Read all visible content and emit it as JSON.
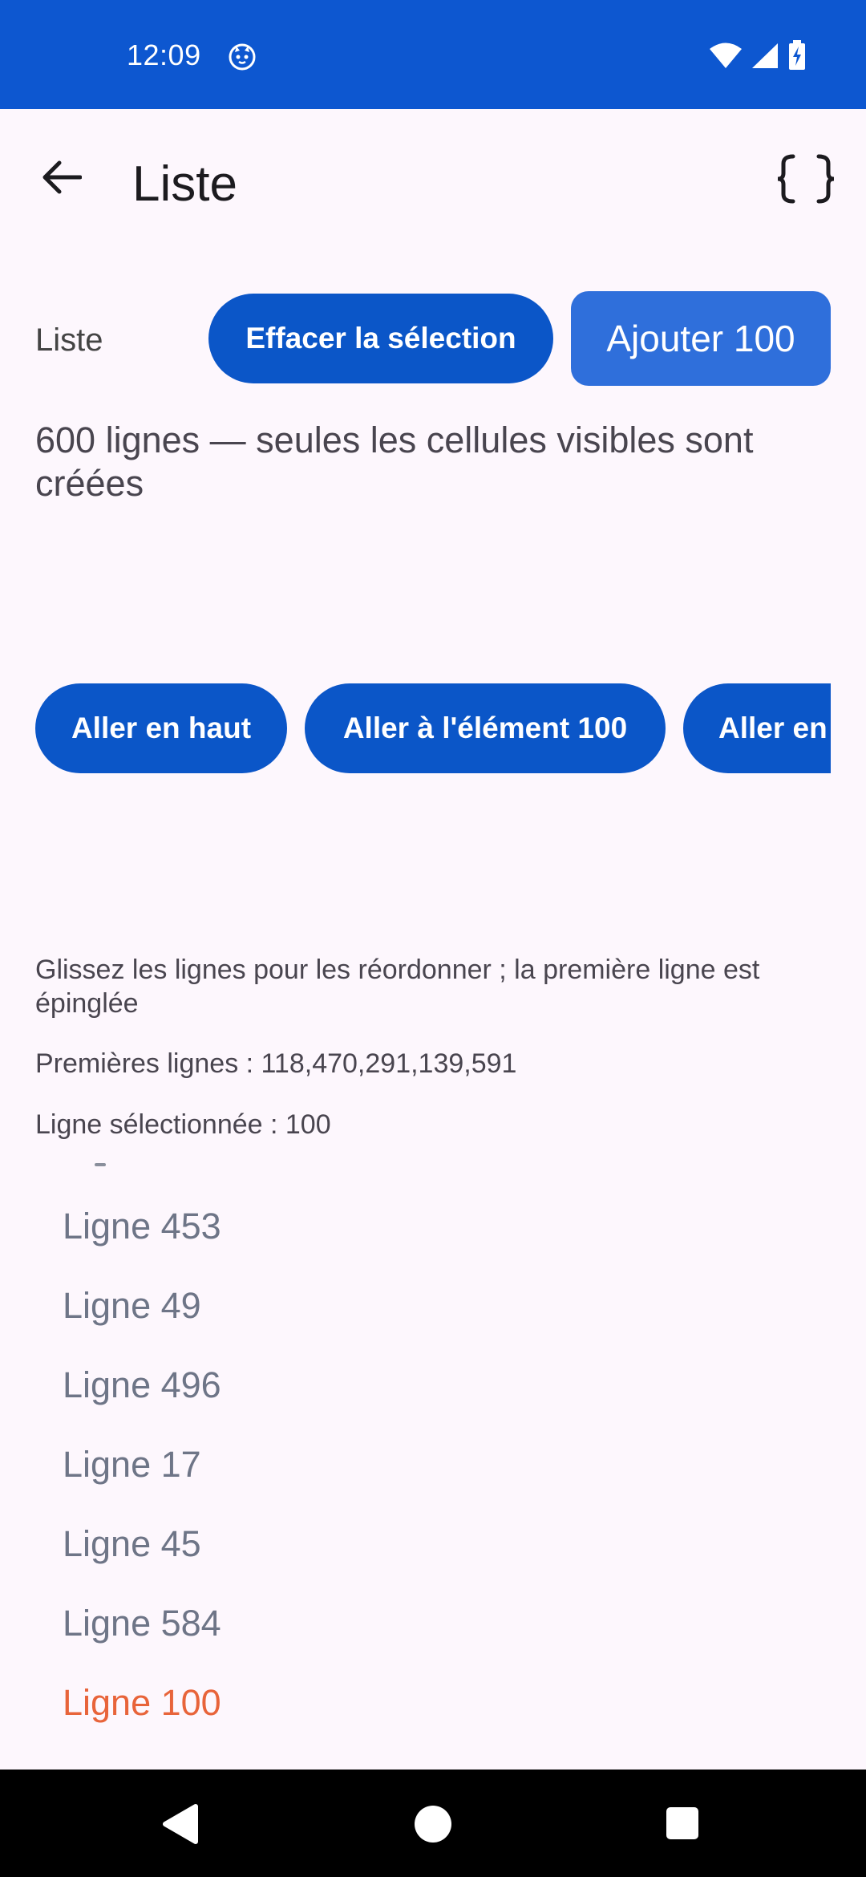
{
  "status_bar": {
    "time": "12:09",
    "app_icon": "cat-face-icon",
    "icons": [
      "wifi-icon",
      "signal-icon",
      "battery-charging-icon"
    ],
    "background": "#0D57D0"
  },
  "app_bar": {
    "title": "Liste",
    "back_icon": "arrow-back-icon",
    "action_icon": "braces-icon"
  },
  "controls": {
    "row_label": "Liste",
    "clear_selection": "Effacer la sélection",
    "add_100": "Ajouter 100"
  },
  "count_text": "600 lignes — seules les cellules visibles sont créées",
  "scroll_buttons": {
    "top": "Aller en haut",
    "goto_100": "Aller à l'élément 100",
    "bottom": "Aller en bas"
  },
  "info": {
    "hint": "Glissez les lignes pour les réordonner ; la première ligne est épinglée",
    "first_rows": "Premières lignes : 118,470,291,139,591",
    "selected": "Ligne sélectionnée : 100"
  },
  "list": {
    "items": [
      "Ligne 453",
      "Ligne 49",
      "Ligne 496",
      "Ligne 17",
      "Ligne 45",
      "Ligne 584",
      "Ligne 100"
    ],
    "selected_item": "Ligne 100",
    "selected_color": "#E8643A",
    "item_color": "#6E7587"
  },
  "nav_bar": {
    "icons": [
      "nav-back-icon",
      "nav-home-icon",
      "nav-recents-icon"
    ]
  },
  "colors": {
    "primary": "#0B56C8",
    "primary_light": "#2F6FDB",
    "background": "#FDF7FD"
  }
}
